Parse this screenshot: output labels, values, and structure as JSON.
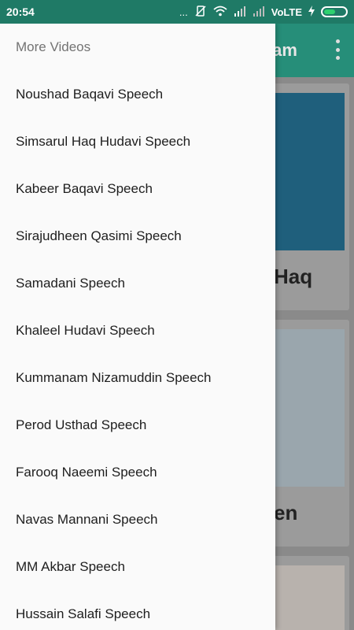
{
  "status_bar": {
    "time": "20:54",
    "dots": "...",
    "network": "VoLTE"
  },
  "app_bar": {
    "title_fragment": "lam"
  },
  "background_cards": [
    {
      "caption": "Haq"
    },
    {
      "caption": "en"
    }
  ],
  "drawer": {
    "header": "More Videos",
    "items": [
      {
        "label": "Noushad Baqavi Speech"
      },
      {
        "label": "Simsarul Haq Hudavi Speech"
      },
      {
        "label": "Kabeer Baqavi Speech"
      },
      {
        "label": "Sirajudheen Qasimi Speech"
      },
      {
        "label": "Samadani Speech"
      },
      {
        "label": "Khaleel Hudavi Speech"
      },
      {
        "label": "Kummanam Nizamuddin Speech"
      },
      {
        "label": "Perod Usthad Speech"
      },
      {
        "label": "Farooq Naeemi Speech"
      },
      {
        "label": "Navas Mannani Speech"
      },
      {
        "label": "MM Akbar Speech"
      },
      {
        "label": "Hussain Salafi Speech"
      }
    ]
  },
  "colors": {
    "status_bar": "#1f7a66",
    "app_bar": "#268e79",
    "drawer_bg": "#fafafa"
  }
}
